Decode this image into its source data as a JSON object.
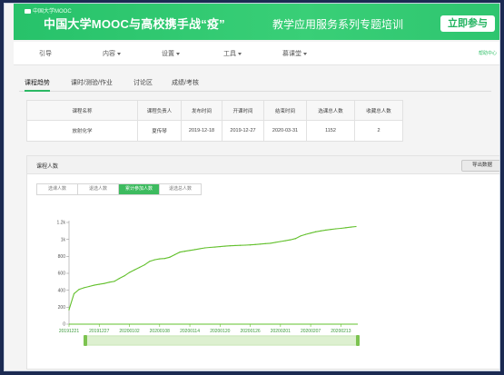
{
  "banner": {
    "logo_text": "中国大学MOOC",
    "headline": "中国大学MOOC与高校携手战“疫”",
    "subline": "教学应用服务系列专题培训",
    "join_label": "立即参与"
  },
  "nav": {
    "items": [
      {
        "label": "引导",
        "caret": false
      },
      {
        "label": "内容",
        "caret": true
      },
      {
        "label": "设置",
        "caret": true
      },
      {
        "label": "工具",
        "caret": true
      },
      {
        "label": "慕课堂",
        "caret": true
      }
    ],
    "help_label": "帮助中心"
  },
  "tabs": [
    "课程趋势",
    "课时/测验/作业",
    "讨论区",
    "成绩/考核"
  ],
  "summary_table": {
    "headers": [
      "课程名称",
      "课程负责人",
      "发布时间",
      "开课时间",
      "结束时间",
      "选课总人数",
      "收藏总人数"
    ],
    "row": [
      "放射化学",
      "夏传琴",
      "2019-12-18",
      "2019-12-27",
      "2020-03-31",
      "1152",
      "2"
    ]
  },
  "card": {
    "title": "课程人数",
    "export_label": "导出数据",
    "segments": [
      "选课人数",
      "退选人数",
      "累计参加人数",
      "退选总人数"
    ],
    "active_segment": 2
  },
  "colors": {
    "brand_green": "#2bc16b",
    "line_green": "#62c02c",
    "tab_green": "#3dbb5f"
  },
  "chart_data": {
    "type": "line",
    "title": "",
    "xlabel": "",
    "ylabel": "",
    "ylim": [
      0,
      1200
    ],
    "y_ticks": [
      "0",
      "200",
      "400",
      "600",
      "800",
      "1k",
      "1.2k"
    ],
    "y_tick_values": [
      0,
      200,
      400,
      600,
      800,
      1000,
      1200
    ],
    "x_tick_labels": [
      "20191221",
      "20191227",
      "20200102",
      "20200108",
      "20200114",
      "20200120",
      "20200126",
      "20200201",
      "20200207",
      "20200213"
    ],
    "x_tick_index": [
      0,
      6,
      12,
      18,
      24,
      30,
      36,
      42,
      48,
      54
    ],
    "series": [
      {
        "values": [
          170,
          360,
          410,
          430,
          445,
          460,
          470,
          480,
          495,
          505,
          540,
          570,
          610,
          640,
          670,
          700,
          740,
          760,
          770,
          775,
          790,
          820,
          850,
          860,
          870,
          880,
          890,
          900,
          905,
          910,
          915,
          920,
          925,
          928,
          930,
          932,
          935,
          940,
          945,
          950,
          955,
          965,
          975,
          985,
          995,
          1010,
          1040,
          1060,
          1075,
          1090,
          1100,
          1110,
          1118,
          1125,
          1130,
          1138,
          1145,
          1152
        ]
      }
    ]
  }
}
